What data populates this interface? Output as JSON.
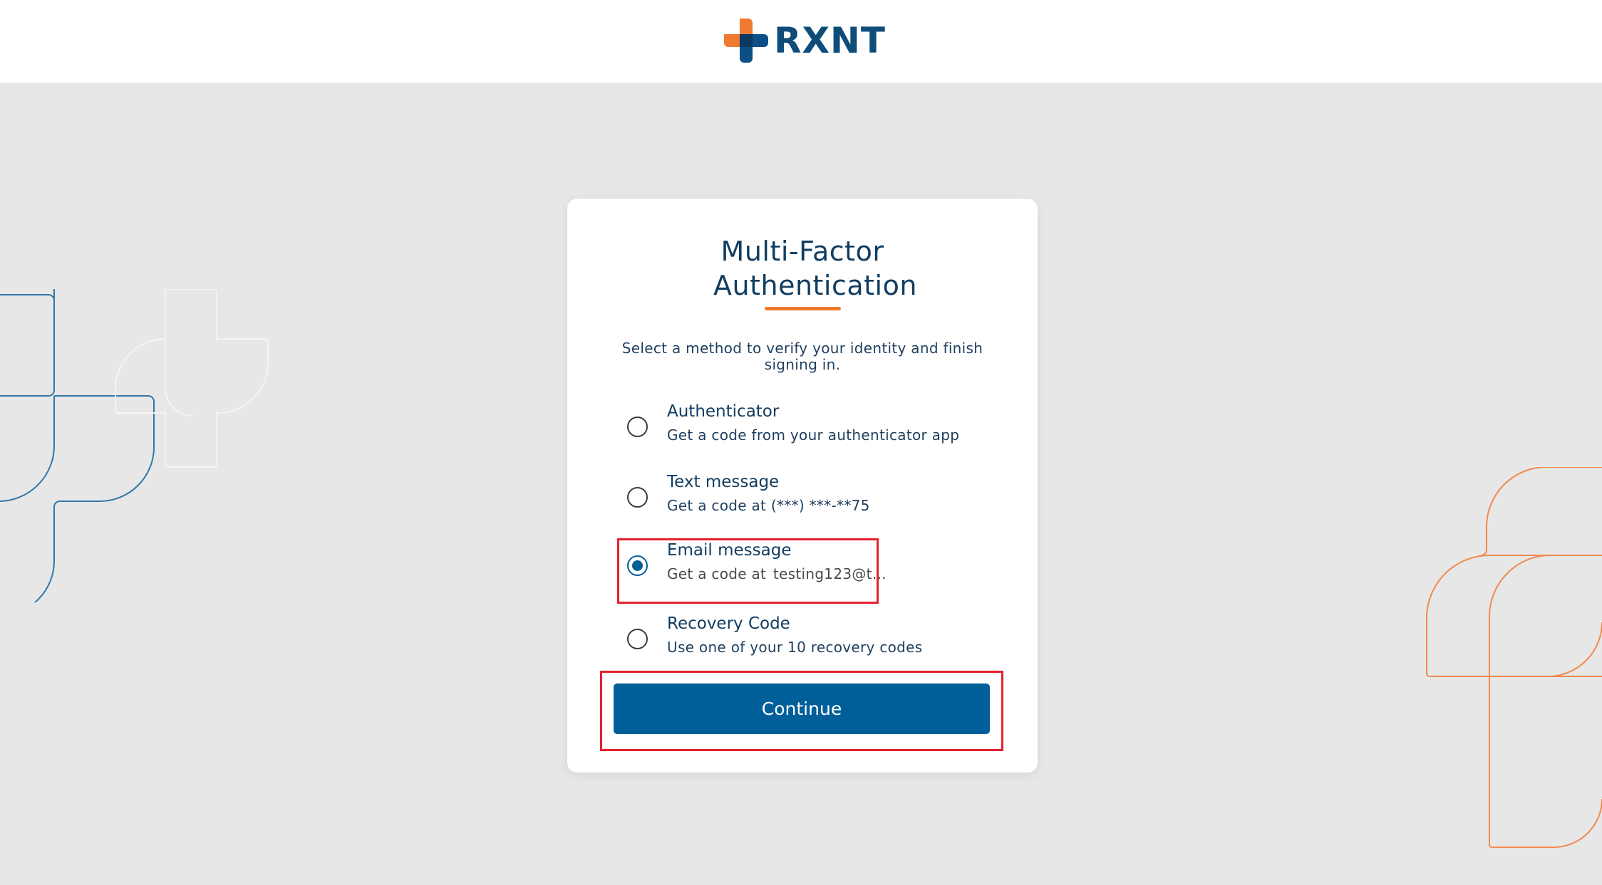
{
  "brand": {
    "name": "RXNT",
    "text_color": "#0e4c7a",
    "mark_orange": "#f07a2f",
    "mark_blue": "#0b4f86"
  },
  "colors": {
    "background": "#e7e7e7",
    "heading": "#123d61",
    "text": "#1f3f5f",
    "accent_rule": "#f07a2f",
    "primary_button": "#005f99",
    "highlight": "#e3222e",
    "deco_blue": "#2f78a8",
    "deco_orange": "#f08a50"
  },
  "card": {
    "title": "Multi-Factor Authentication",
    "subtitle": "Select a method to verify your identity and finish signing in."
  },
  "options": [
    {
      "id": "authenticator",
      "title": "Authenticator",
      "description": "Get a code from your authenticator app",
      "selected": false
    },
    {
      "id": "text-message",
      "title": "Text message",
      "description": "Get a code at (***) ***-**75",
      "selected": false
    },
    {
      "id": "email-message",
      "title": "Email message",
      "description_prefix": "Get a code at",
      "description_value": "testing123@t...",
      "selected": true
    },
    {
      "id": "recovery-code",
      "title": "Recovery Code",
      "description": "Use one of your 10 recovery codes",
      "selected": false
    }
  ],
  "continue_button": {
    "label": "Continue"
  }
}
